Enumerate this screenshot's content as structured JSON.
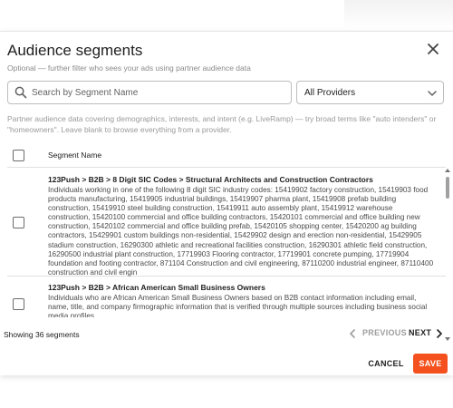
{
  "dialog": {
    "title": "Audience segments",
    "subtitle": "Optional — further filter who sees your ads using partner audience data",
    "close_icon": "close-icon"
  },
  "search": {
    "placeholder": "Search by Segment Name",
    "value": "",
    "icon": "search-icon"
  },
  "provider_select": {
    "selected": "All Providers",
    "icon": "chevron-down-icon"
  },
  "hint": "Partner audience data covering demographics, interests, and intent (e.g. LiveRamp) — try broad terms like \"auto intenders\" or \"homeowners\". Leave blank to browse everything from a provider.",
  "table": {
    "column_header": "Segment Name",
    "rows": [
      {
        "title": "123Push > B2B > 8 Digit SIC Codes > Structural Architects and Construction Contractors",
        "description": "Individuals working in one of the following 8 digit SIC industry codes: 15419902 factory construction, 15419903 food products manufacturing, 15419905 industrial buildings, 15419907 pharma plant, 15419908 prefab building construction, 15419910 steel building construction, 15419911 auto assembly plant, 15419912 warehouse construction, 15420100 commercial and office building contractors, 15420101 commercial and office building new construction, 15420102 commercial and office building prefab, 15420105 shopping center, 15420200 ag building contractors, 15429901 custom buildings non-residential, 15429902 design and erection non-residential, 15429905 stadium construction, 16290300 athletic and recreational facilities construction, 16290301 athletic field construction, 16290500 industrial plant construction, 17719903 Flooring contractor, 17719901 concrete pumping, 17719904 foundation and footing contractor, 871104 Construction and civil engineering, 87110200 industrial engineer, 87110400 construction and civil engin",
        "checked": false
      },
      {
        "title": "123Push > B2B > African American Small Business Owners",
        "description": "Individuals who are African American Small Business Owners based on B2B contact information including email, name, title, and company firmographic information that is verified through multiple sources including business social media profiles.",
        "checked": false
      }
    ]
  },
  "footer": {
    "count_text": "Showing 36 segments",
    "prev_label": "PREVIOUS",
    "next_label": "NEXT",
    "cancel_label": "CANCEL",
    "save_label": "SAVE"
  },
  "colors": {
    "accent": "#f4511e",
    "text": "#212121",
    "muted": "#9e9e9e"
  }
}
